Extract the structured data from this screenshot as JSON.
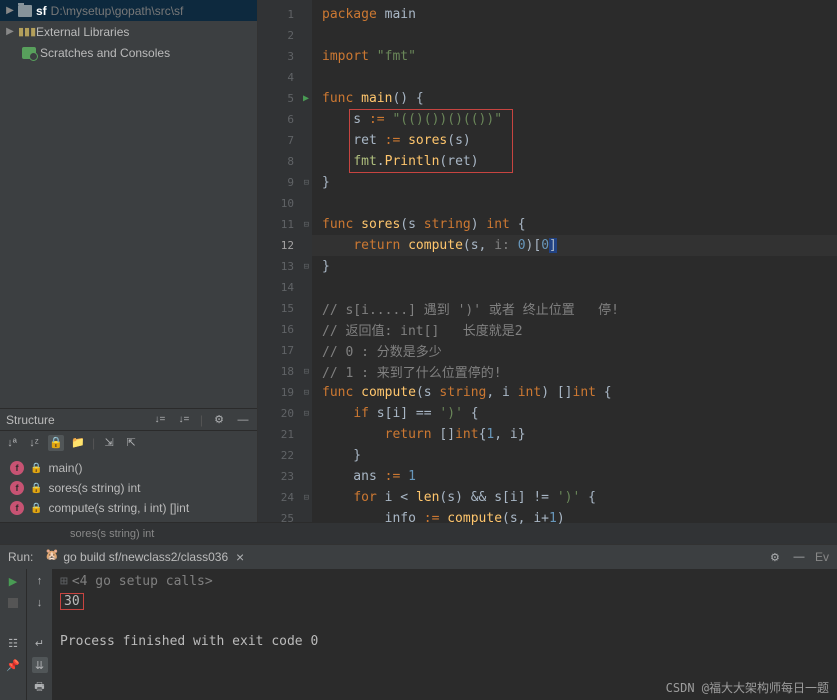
{
  "project": {
    "rootName": "sf",
    "rootPath": "D:\\mysetup\\gopath\\src\\sf",
    "externalLibs": "External Libraries",
    "scratches": "Scratches and Consoles"
  },
  "structure": {
    "title": "Structure",
    "items": [
      {
        "label": "main()"
      },
      {
        "label": "sores(s string) int"
      },
      {
        "label": "compute(s string, i int) []int"
      }
    ]
  },
  "editor": {
    "lines": [
      {
        "n": 1,
        "tokens": [
          [
            "kw",
            "package "
          ],
          [
            "def",
            "main"
          ]
        ]
      },
      {
        "n": 2,
        "tokens": []
      },
      {
        "n": 3,
        "tokens": [
          [
            "kw",
            "import "
          ],
          [
            "str",
            "\"fmt\""
          ]
        ]
      },
      {
        "n": 4,
        "tokens": []
      },
      {
        "n": 5,
        "run": true,
        "fold": true,
        "tokens": [
          [
            "kw",
            "func "
          ],
          [
            "fn",
            "main"
          ],
          [
            "def",
            "() {"
          ]
        ]
      },
      {
        "n": 6,
        "tokens": [
          [
            "def",
            "    s "
          ],
          [
            "kw",
            ":= "
          ],
          [
            "str",
            "\"(()())()(())\""
          ]
        ]
      },
      {
        "n": 7,
        "tokens": [
          [
            "def",
            "    ret "
          ],
          [
            "kw",
            ":= "
          ],
          [
            "fn",
            "sores"
          ],
          [
            "def",
            "(s)"
          ]
        ]
      },
      {
        "n": 8,
        "tokens": [
          [
            "def",
            "    "
          ],
          [
            "pkg",
            "fmt"
          ],
          [
            "def",
            "."
          ],
          [
            "fn",
            "Println"
          ],
          [
            "def",
            "(ret)"
          ]
        ]
      },
      {
        "n": 9,
        "fold": true,
        "tokens": [
          [
            "def",
            "}"
          ]
        ]
      },
      {
        "n": 10,
        "tokens": []
      },
      {
        "n": 11,
        "fold": true,
        "tokens": [
          [
            "kw",
            "func "
          ],
          [
            "fn",
            "sores"
          ],
          [
            "def",
            "(s "
          ],
          [
            "typ",
            "string"
          ],
          [
            "def",
            ") "
          ],
          [
            "typ",
            "int"
          ],
          [
            "def",
            " {"
          ]
        ]
      },
      {
        "n": 12,
        "cur": true,
        "tokens": [
          [
            "def",
            "    "
          ],
          [
            "kw",
            "return "
          ],
          [
            "fn",
            "compute"
          ],
          [
            "def",
            "(s, "
          ],
          [
            "cmt",
            "i: "
          ],
          [
            "num",
            "0"
          ],
          [
            "def",
            ")["
          ],
          [
            "num",
            "0"
          ],
          [
            "hl",
            "]"
          ]
        ]
      },
      {
        "n": 13,
        "fold": true,
        "tokens": [
          [
            "def",
            "}"
          ]
        ]
      },
      {
        "n": 14,
        "tokens": []
      },
      {
        "n": 15,
        "tokens": [
          [
            "cmt",
            "// s[i.....] 遇到 ')' 或者 终止位置   停!"
          ]
        ]
      },
      {
        "n": 16,
        "tokens": [
          [
            "cmt",
            "// 返回值: int[]   长度就是2"
          ]
        ]
      },
      {
        "n": 17,
        "tokens": [
          [
            "cmt",
            "// 0 : 分数是多少"
          ]
        ]
      },
      {
        "n": 18,
        "fold": true,
        "tokens": [
          [
            "cmt",
            "// 1 : 来到了什么位置停的!"
          ]
        ]
      },
      {
        "n": 19,
        "fold": true,
        "tokens": [
          [
            "kw",
            "func "
          ],
          [
            "fn",
            "compute"
          ],
          [
            "def",
            "(s "
          ],
          [
            "typ",
            "string"
          ],
          [
            "def",
            ", i "
          ],
          [
            "typ",
            "int"
          ],
          [
            "def",
            ") []"
          ],
          [
            "typ",
            "int"
          ],
          [
            "def",
            " {"
          ]
        ]
      },
      {
        "n": 20,
        "fold": true,
        "tokens": [
          [
            "def",
            "    "
          ],
          [
            "kw",
            "if "
          ],
          [
            "def",
            "s[i] == "
          ],
          [
            "str",
            "')'"
          ],
          [
            "def",
            " {"
          ]
        ]
      },
      {
        "n": 21,
        "tokens": [
          [
            "def",
            "        "
          ],
          [
            "kw",
            "return "
          ],
          [
            "def",
            "[]"
          ],
          [
            "typ",
            "int"
          ],
          [
            "def",
            "{"
          ],
          [
            "num",
            "1"
          ],
          [
            "def",
            ", i}"
          ]
        ]
      },
      {
        "n": 22,
        "tokens": [
          [
            "def",
            "    }"
          ]
        ]
      },
      {
        "n": 23,
        "tokens": [
          [
            "def",
            "    ans "
          ],
          [
            "kw",
            ":= "
          ],
          [
            "num",
            "1"
          ]
        ]
      },
      {
        "n": 24,
        "fold": true,
        "tokens": [
          [
            "def",
            "    "
          ],
          [
            "kw",
            "for "
          ],
          [
            "def",
            "i < "
          ],
          [
            "fn",
            "len"
          ],
          [
            "def",
            "(s) && s[i] != "
          ],
          [
            "str",
            "')'"
          ],
          [
            "def",
            " {"
          ]
        ]
      },
      {
        "n": 25,
        "tokens": [
          [
            "def",
            "        info "
          ],
          [
            "kw",
            ":= "
          ],
          [
            "fn",
            "compute"
          ],
          [
            "def",
            "(s, i+"
          ],
          [
            "num",
            "1"
          ],
          [
            "def",
            ")"
          ]
        ]
      }
    ],
    "breadcrumb": "sores(s string) int"
  },
  "run": {
    "title": "Run:",
    "tabLabel": "go build sf/newclass2/class036",
    "setupLine": "<4 go setup calls>",
    "outputValue": "30",
    "exitLine": "Process finished with exit code 0"
  },
  "watermark": "CSDN @福大大架构师每日一题",
  "rightLabel": "Ev"
}
